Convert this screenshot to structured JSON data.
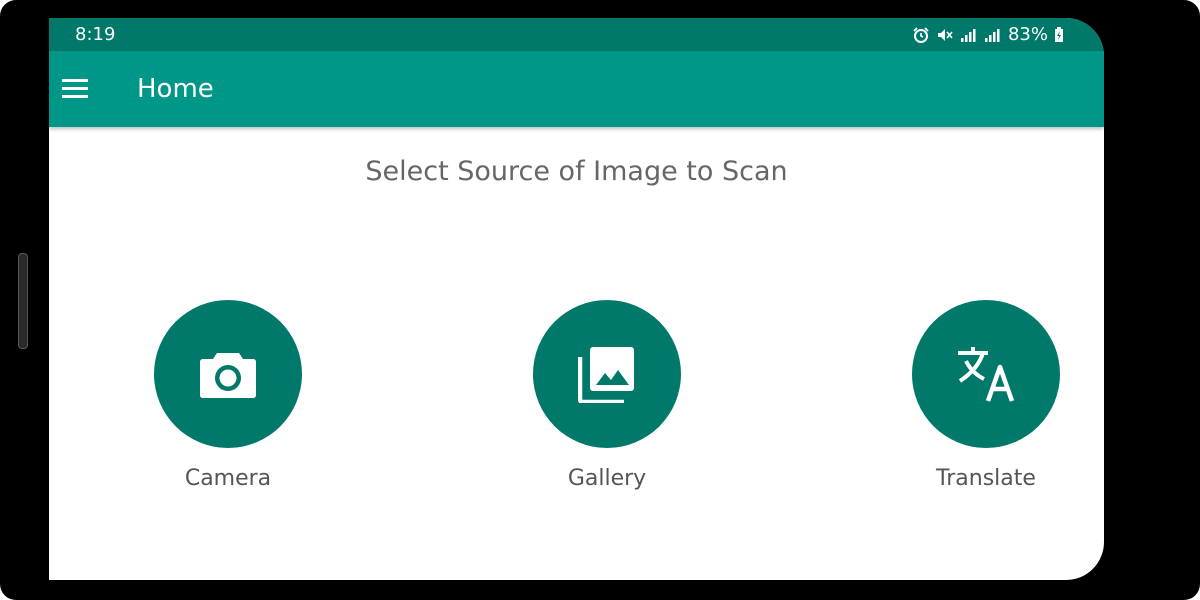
{
  "status_bar": {
    "time": "8:19",
    "battery": "83%",
    "icons": [
      "alarm-icon",
      "mute-icon",
      "signal-icon",
      "signal-icon",
      "battery-charging-icon"
    ],
    "color": "#00796b"
  },
  "app_bar": {
    "title": "Home",
    "menu_icon": "hamburger-menu-icon",
    "color": "#009688"
  },
  "main": {
    "heading": "Select Source of Image to Scan",
    "options": [
      {
        "label": "Camera",
        "icon": "camera-icon"
      },
      {
        "label": "Gallery",
        "icon": "gallery-icon"
      },
      {
        "label": "Translate",
        "icon": "translate-icon"
      }
    ],
    "circle_color": "#00796b"
  }
}
